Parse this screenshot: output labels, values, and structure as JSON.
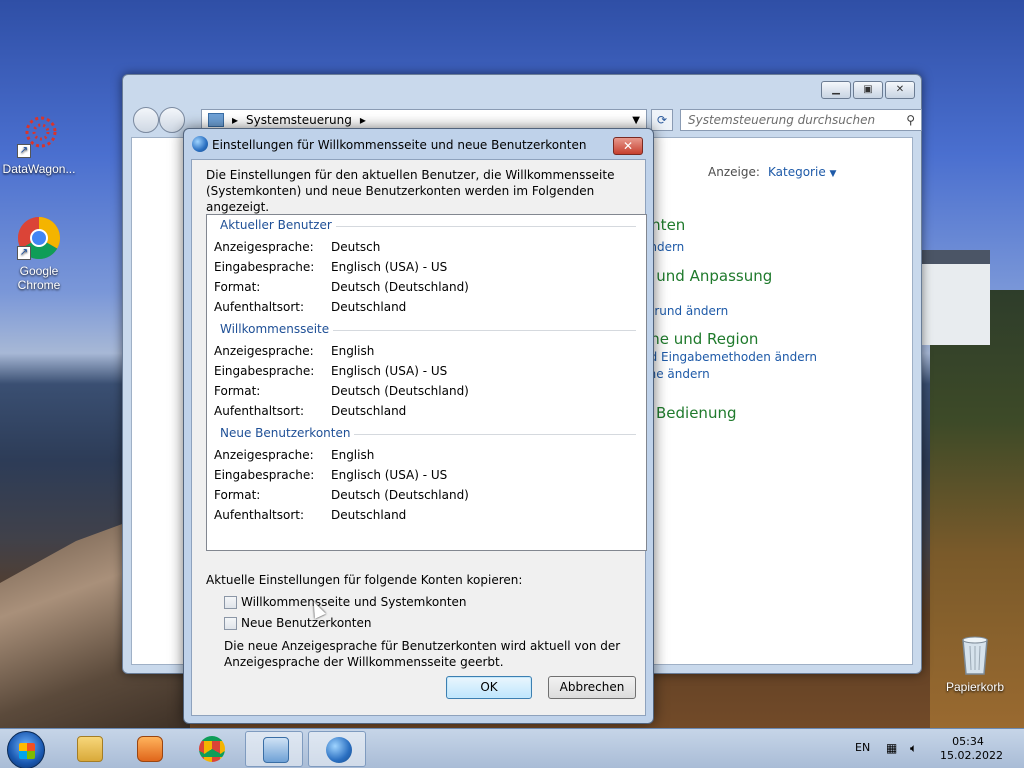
{
  "desktop": {
    "icons": [
      {
        "label": "DataWagon..."
      },
      {
        "label": "Google Chrome"
      },
      {
        "label": "Papierkorb"
      }
    ]
  },
  "control_panel": {
    "breadcrumb": "Systemsteuerung",
    "search_placeholder": "Systemsteuerung durchsuchen",
    "view_label": "Anzeige:",
    "view_value": "Kategorie",
    "categories": [
      {
        "title": "onten",
        "links": [
          "ändern"
        ]
      },
      {
        "title": "g und Anpassung",
        "links": [
          "n",
          "rgrund ändern"
        ]
      },
      {
        "title": "che und Region",
        "links": [
          "nd Eingabemethoden ändern",
          "che ändern"
        ]
      },
      {
        "title": "e Bedienung",
        "links": []
      }
    ]
  },
  "dialog": {
    "title": "Einstellungen für Willkommensseite und neue Benutzerkonten",
    "intro": "Die Einstellungen für den aktuellen Benutzer, die Willkommensseite (Systemkonten) und neue Benutzerkonten werden im Folgenden angezeigt.",
    "groups": [
      {
        "header": "Aktueller Benutzer",
        "rows": [
          {
            "label": "Anzeigesprache:",
            "value": "Deutsch"
          },
          {
            "label": "Eingabesprache:",
            "value": "Englisch (USA) - US"
          },
          {
            "label": "Format:",
            "value": "Deutsch (Deutschland)"
          },
          {
            "label": "Aufenthaltsort:",
            "value": "Deutschland"
          }
        ]
      },
      {
        "header": "Willkommensseite",
        "rows": [
          {
            "label": "Anzeigesprache:",
            "value": "English"
          },
          {
            "label": "Eingabesprache:",
            "value": "Englisch (USA) - US"
          },
          {
            "label": "Format:",
            "value": "Deutsch (Deutschland)"
          },
          {
            "label": "Aufenthaltsort:",
            "value": "Deutschland"
          }
        ]
      },
      {
        "header": "Neue Benutzerkonten",
        "rows": [
          {
            "label": "Anzeigesprache:",
            "value": "English"
          },
          {
            "label": "Eingabesprache:",
            "value": "Englisch (USA) - US"
          },
          {
            "label": "Format:",
            "value": "Deutsch (Deutschland)"
          },
          {
            "label": "Aufenthaltsort:",
            "value": "Deutschland"
          }
        ]
      }
    ],
    "copy_label": "Aktuelle Einstellungen für folgende Konten kopieren:",
    "checkboxes": [
      {
        "label": "Willkommensseite und Systemkonten",
        "checked": false
      },
      {
        "label": "Neue Benutzerkonten",
        "checked": false
      }
    ],
    "note": "Die neue Anzeigesprache für Benutzerkonten wird aktuell von der Anzeigesprache der Willkommensseite geerbt.",
    "ok_label": "OK",
    "cancel_label": "Abbrechen"
  },
  "taskbar": {
    "language": "EN",
    "time": "05:34",
    "date": "15.02.2022"
  }
}
